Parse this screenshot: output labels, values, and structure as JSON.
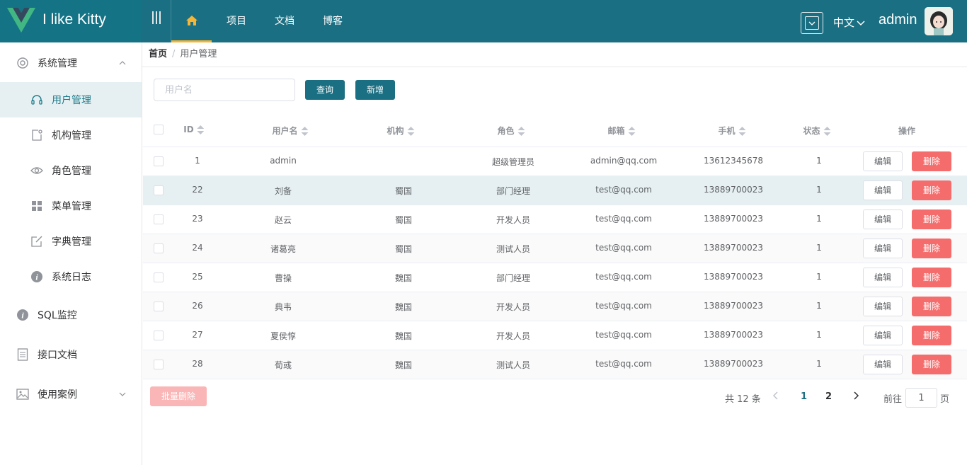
{
  "header": {
    "app_title": "I like Kitty",
    "nav": [
      {
        "label": "项目"
      },
      {
        "label": "文档"
      },
      {
        "label": "博客"
      }
    ],
    "language": "中文",
    "username": "admin"
  },
  "sidebar": {
    "items": [
      {
        "label": "系统管理",
        "icon": "gear-icon"
      },
      {
        "label": "用户管理",
        "icon": "headset-icon"
      },
      {
        "label": "机构管理",
        "icon": "org-icon"
      },
      {
        "label": "角色管理",
        "icon": "eye-icon"
      },
      {
        "label": "菜单管理",
        "icon": "grid-icon"
      },
      {
        "label": "字典管理",
        "icon": "edit-icon"
      },
      {
        "label": "系统日志",
        "icon": "info-icon"
      },
      {
        "label": "SQL监控",
        "icon": "info-icon"
      },
      {
        "label": "接口文档",
        "icon": "document-icon"
      },
      {
        "label": "使用案例",
        "icon": "picture-icon"
      }
    ]
  },
  "breadcrumb": {
    "home": "首页",
    "separator": "/",
    "current": "用户管理"
  },
  "toolbar": {
    "search_placeholder": "用户名",
    "query_label": "查询",
    "add_label": "新增"
  },
  "table": {
    "columns": [
      "ID",
      "用户名",
      "机构",
      "角色",
      "邮箱",
      "手机",
      "状态",
      "操作"
    ],
    "edit_label": "编辑",
    "delete_label": "删除",
    "rows": [
      {
        "id": "1",
        "name": "admin",
        "org": "",
        "role": "超级管理员",
        "email": "admin@qq.com",
        "phone": "13612345678",
        "status": "1"
      },
      {
        "id": "22",
        "name": "刘备",
        "org": "蜀国",
        "role": "部门经理",
        "email": "test@qq.com",
        "phone": "13889700023",
        "status": "1"
      },
      {
        "id": "23",
        "name": "赵云",
        "org": "蜀国",
        "role": "开发人员",
        "email": "test@qq.com",
        "phone": "13889700023",
        "status": "1"
      },
      {
        "id": "24",
        "name": "诸葛亮",
        "org": "蜀国",
        "role": "测试人员",
        "email": "test@qq.com",
        "phone": "13889700023",
        "status": "1"
      },
      {
        "id": "25",
        "name": "曹操",
        "org": "魏国",
        "role": "部门经理",
        "email": "test@qq.com",
        "phone": "13889700023",
        "status": "1"
      },
      {
        "id": "26",
        "name": "典韦",
        "org": "魏国",
        "role": "开发人员",
        "email": "test@qq.com",
        "phone": "13889700023",
        "status": "1"
      },
      {
        "id": "27",
        "name": "夏侯惇",
        "org": "魏国",
        "role": "开发人员",
        "email": "test@qq.com",
        "phone": "13889700023",
        "status": "1"
      },
      {
        "id": "28",
        "name": "荀彧",
        "org": "魏国",
        "role": "测试人员",
        "email": "test@qq.com",
        "phone": "13889700023",
        "status": "1"
      }
    ]
  },
  "footer": {
    "batch_delete_label": "批量删除",
    "total_text": "共 12 条",
    "pages": [
      "1",
      "2"
    ],
    "goto_label": "前往",
    "goto_value": "1",
    "page_suffix": "页"
  },
  "colors": {
    "header_bg": "#1b6f82",
    "accent": "#f5b537",
    "danger": "#f56c6c"
  }
}
